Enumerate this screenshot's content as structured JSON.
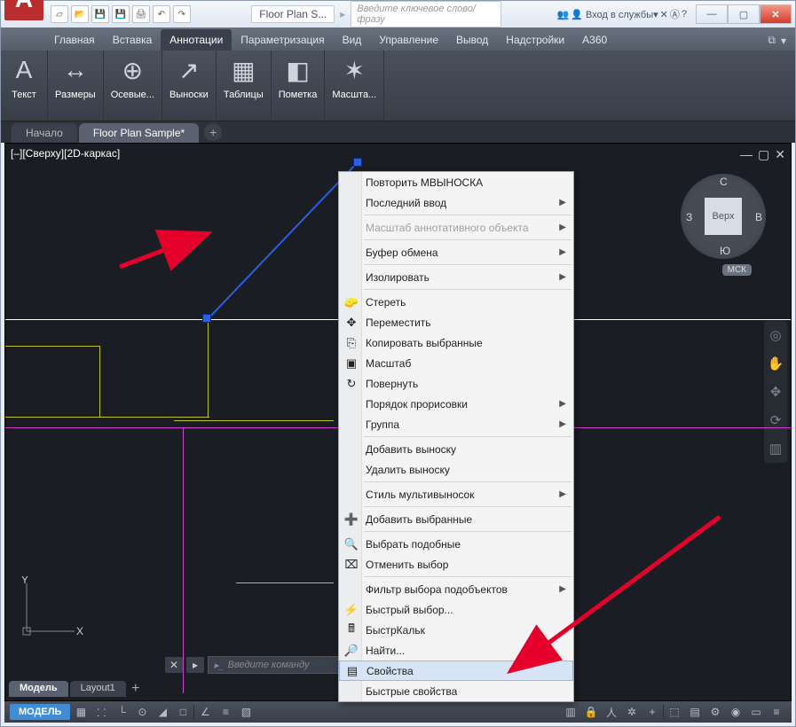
{
  "window": {
    "doc_title": "Floor Plan S...",
    "search_placeholder": "Введите ключевое слово/фразу",
    "signin": "Вход в службы",
    "app_letter": "A"
  },
  "ribbon_tabs": [
    "Главная",
    "Вставка",
    "Аннотации",
    "Параметризация",
    "Вид",
    "Управление",
    "Вывод",
    "Надстройки",
    "A360"
  ],
  "ribbon_tabs_active_index": 2,
  "ribbon_groups": [
    {
      "label": "Текст",
      "glyph": "A"
    },
    {
      "label": "Размеры",
      "glyph": "↔"
    },
    {
      "label": "Осевые...",
      "glyph": "⊕"
    },
    {
      "label": "Выноски",
      "glyph": "↗"
    },
    {
      "label": "Таблицы",
      "glyph": "▦"
    },
    {
      "label": "Пометка",
      "glyph": "◧"
    },
    {
      "label": "Масшта...",
      "glyph": "✶"
    }
  ],
  "doctabs": {
    "start": "Начало",
    "active": "Floor Plan Sample*"
  },
  "view_label": "[–][Сверху][2D-каркас]",
  "viewcube": {
    "face": "Верх",
    "n": "С",
    "s": "Ю",
    "e": "В",
    "w": "З",
    "wcs": "МСК"
  },
  "layout_tabs": {
    "model": "Модель",
    "layout1": "Layout1"
  },
  "cmd_placeholder": "Введите команду",
  "status_model": "МОДЕЛЬ",
  "ucs": {
    "x": "X",
    "y": "Y"
  },
  "ctxmenu": [
    {
      "type": "item",
      "label": "Повторить МВЫНОСКА"
    },
    {
      "type": "item",
      "label": "Последний ввод",
      "sub": true
    },
    {
      "type": "sep"
    },
    {
      "type": "item",
      "label": "Масштаб аннотативного объекта",
      "sub": true,
      "disabled": true
    },
    {
      "type": "sep"
    },
    {
      "type": "item",
      "label": "Буфер обмена",
      "sub": true
    },
    {
      "type": "sep"
    },
    {
      "type": "item",
      "label": "Изолировать",
      "sub": true
    },
    {
      "type": "sep"
    },
    {
      "type": "item",
      "label": "Стереть",
      "icon": "erase"
    },
    {
      "type": "item",
      "label": "Переместить",
      "icon": "move"
    },
    {
      "type": "item",
      "label": "Копировать выбранные",
      "icon": "copy"
    },
    {
      "type": "item",
      "label": "Масштаб",
      "icon": "scale"
    },
    {
      "type": "item",
      "label": "Повернуть",
      "icon": "rotate"
    },
    {
      "type": "item",
      "label": "Порядок прорисовки",
      "sub": true
    },
    {
      "type": "item",
      "label": "Группа",
      "sub": true
    },
    {
      "type": "sep"
    },
    {
      "type": "item",
      "label": "Добавить выноску"
    },
    {
      "type": "item",
      "label": "Удалить выноску"
    },
    {
      "type": "sep"
    },
    {
      "type": "item",
      "label": "Стиль мультивыносок",
      "sub": true
    },
    {
      "type": "sep"
    },
    {
      "type": "item",
      "label": "Добавить выбранные",
      "icon": "addsel"
    },
    {
      "type": "sep"
    },
    {
      "type": "item",
      "label": "Выбрать подобные",
      "icon": "selsim"
    },
    {
      "type": "item",
      "label": "Отменить выбор",
      "icon": "desel"
    },
    {
      "type": "sep"
    },
    {
      "type": "item",
      "label": "Фильтр выбора подобъектов",
      "sub": true
    },
    {
      "type": "item",
      "label": "Быстрый выбор...",
      "icon": "qsel"
    },
    {
      "type": "item",
      "label": "БыстрКальк",
      "icon": "calc"
    },
    {
      "type": "item",
      "label": "Найти...",
      "icon": "find"
    },
    {
      "type": "item",
      "label": "Свойства",
      "icon": "props",
      "highlight": true
    },
    {
      "type": "item",
      "label": "Быстрые свойства"
    }
  ]
}
